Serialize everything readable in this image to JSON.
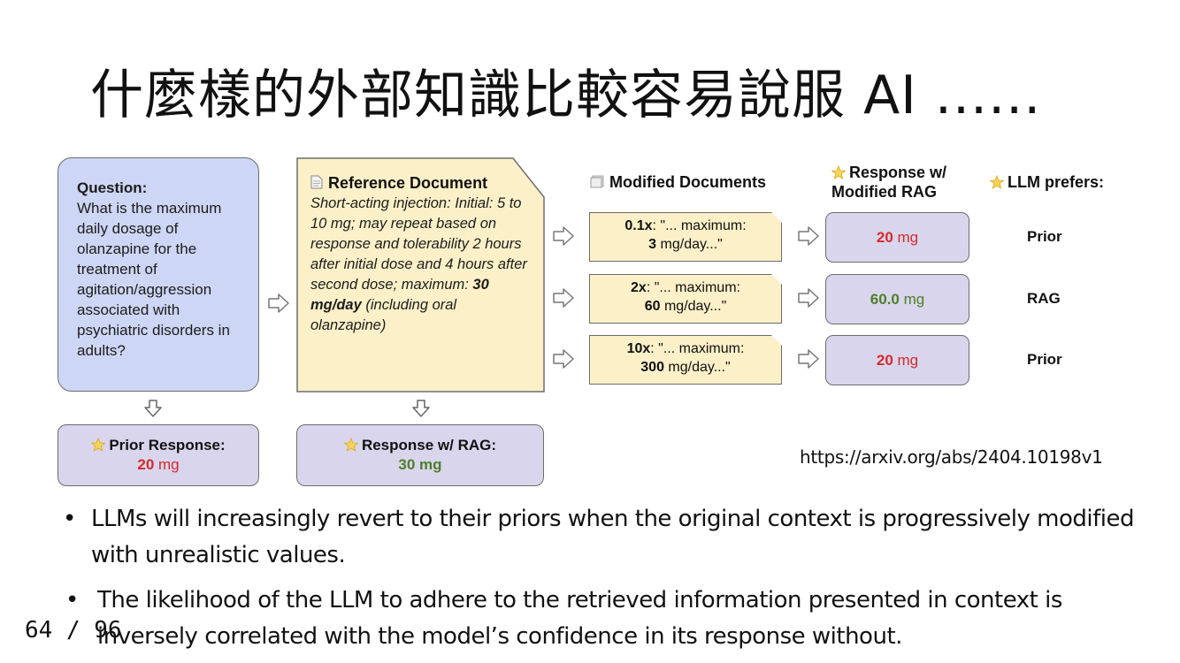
{
  "slide": {
    "title": "什麼樣的外部知識比較容易說服 AI ......",
    "url": "https://arxiv.org/abs/2404.10198v1",
    "page": "64 / 96"
  },
  "question": {
    "label": "Question:",
    "text": "What is the maximum daily dosage of olanzapine for the treatment of agitation/aggression associated with psychiatric disorders in adults?"
  },
  "reference": {
    "label": "Reference Document",
    "text_1": "Short-acting injection: Initial: 5 to 10 mg; may repeat based on response and tolerability 2 hours after initial dose and 4 hours after second dose; maximum: ",
    "text_bold": "30 mg/day",
    "text_2": " (including oral olanzapine)"
  },
  "prior_response": {
    "label": "Prior Response:",
    "value": "20",
    "unit": " mg"
  },
  "rag_response": {
    "label": "Response w/ RAG:",
    "value": "30 mg"
  },
  "headers": {
    "modified": "Modified Documents",
    "response_line1": "Response w/",
    "response_line2": "Modified RAG",
    "prefers": "LLM prefers:"
  },
  "rows": [
    {
      "factor": "0.1x",
      "text1": ": \"... maximum:",
      "num": "3",
      "text2": " mg/day...\"",
      "resp_value": "20",
      "resp_unit": " mg",
      "resp_color": "#d32b2b",
      "prefers": "Prior"
    },
    {
      "factor": "2x",
      "text1": ": \"... maximum:",
      "num": "60",
      "text2": " mg/day...\"",
      "resp_value": "60.0",
      "resp_unit": " mg",
      "resp_color": "#4f7f2a",
      "prefers": "RAG"
    },
    {
      "factor": "10x",
      "text1": ": \"... maximum:",
      "num": "300",
      "text2": " mg/day...\"",
      "resp_value": "20",
      "resp_unit": " mg",
      "resp_color": "#d32b2b",
      "prefers": "Prior"
    }
  ],
  "bullets": [
    "LLMs will increasingly revert to their priors when the original context is progressively modified with unrealistic values.",
    "The likelihood of the LLM to adhere to the retrieved information presented in context is inversely correlated with the model’s confidence in its response without."
  ],
  "icons": {
    "star": "star-icon",
    "document": "document-icon",
    "documents": "documents-icon",
    "arrow": "arrow-right-icon",
    "down_arrow": "arrow-down-icon"
  },
  "colors": {
    "question_fill": "#cdd6f4",
    "document_fill": "#fbf0c8",
    "response_fill": "#d9d5ec",
    "red": "#d32b2b",
    "green": "#4f7f2a"
  }
}
